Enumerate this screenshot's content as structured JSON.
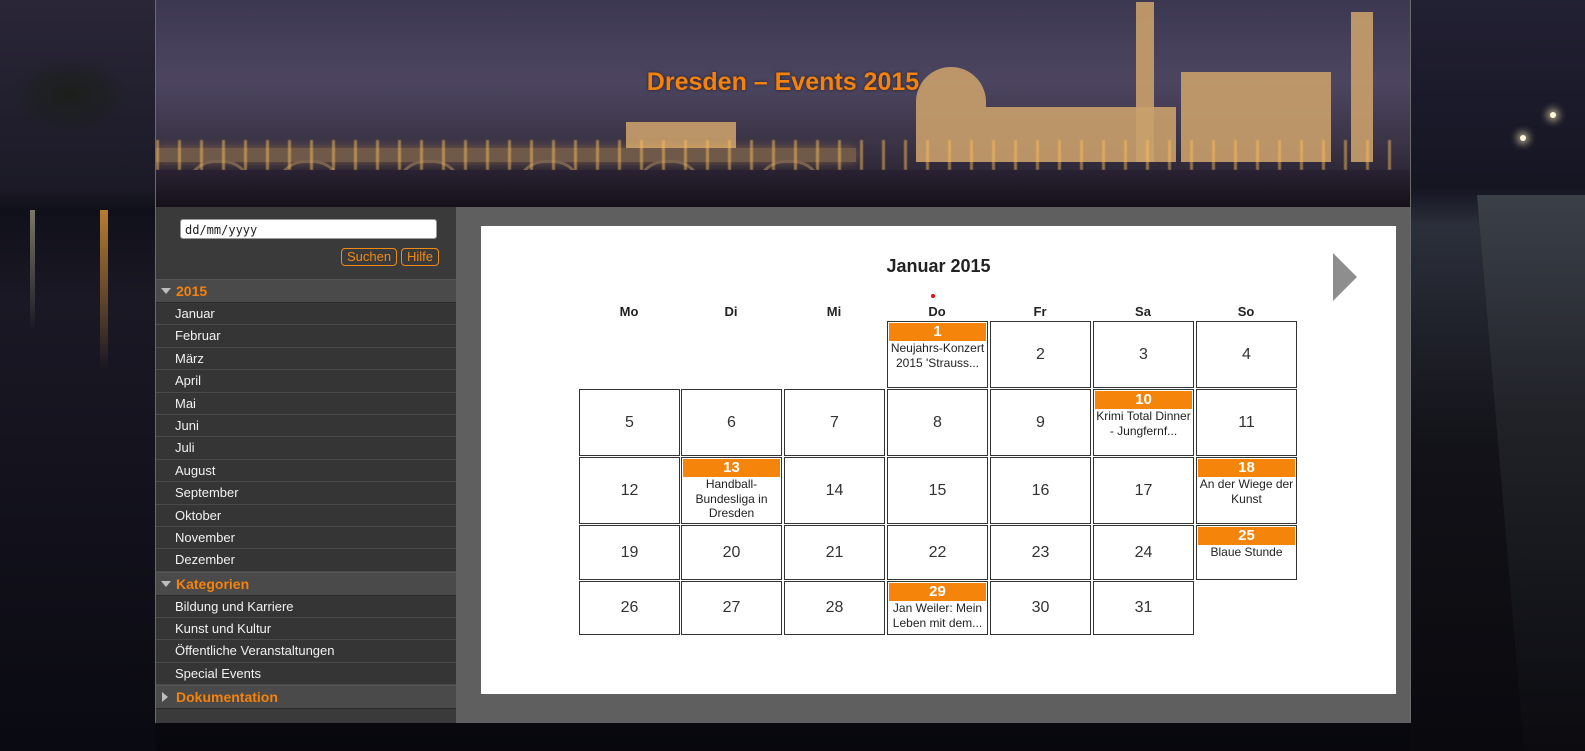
{
  "header": {
    "title": "Dresden – Events 2015"
  },
  "search": {
    "placeholder": "dd/mm/yyyy",
    "search_label": "Suchen",
    "help_label": "Hilfe"
  },
  "sidebar": {
    "year_label": "2015",
    "months": [
      "Januar",
      "Februar",
      "März",
      "April",
      "Mai",
      "Juni",
      "Juli",
      "August",
      "September",
      "Oktober",
      "November",
      "Dezember"
    ],
    "categories_label": "Kategorien",
    "categories": [
      "Bildung und Karriere",
      "Kunst und Kultur",
      "Öffentliche Veranstaltungen",
      "Special Events"
    ],
    "documentation_label": "Dokumentation"
  },
  "calendar": {
    "title": "Januar 2015",
    "weekdays": [
      "Mo",
      "Di",
      "Mi",
      "Do",
      "Fr",
      "Sa",
      "So"
    ],
    "weeks": [
      [
        null,
        null,
        null,
        {
          "day": "1",
          "event": "Neujahrs-Konzert 2015 'Strauss..."
        },
        {
          "day": "2"
        },
        {
          "day": "3"
        },
        {
          "day": "4"
        }
      ],
      [
        {
          "day": "5"
        },
        {
          "day": "6"
        },
        {
          "day": "7"
        },
        {
          "day": "8"
        },
        {
          "day": "9"
        },
        {
          "day": "10",
          "event": "Krimi Total Dinner - Jungfernf..."
        },
        {
          "day": "11"
        }
      ],
      [
        {
          "day": "12"
        },
        {
          "day": "13",
          "event": "Handball-Bundesliga in Dresden"
        },
        {
          "day": "14"
        },
        {
          "day": "15"
        },
        {
          "day": "16"
        },
        {
          "day": "17"
        },
        {
          "day": "18",
          "event": "An der Wiege der Kunst"
        }
      ],
      [
        {
          "day": "19"
        },
        {
          "day": "20"
        },
        {
          "day": "21"
        },
        {
          "day": "22"
        },
        {
          "day": "23"
        },
        {
          "day": "24"
        },
        {
          "day": "25",
          "event": "Blaue Stunde"
        }
      ],
      [
        {
          "day": "26"
        },
        {
          "day": "27"
        },
        {
          "day": "28"
        },
        {
          "day": "29",
          "event": "Jan Weiler: Mein Leben mit dem..."
        },
        {
          "day": "30"
        },
        {
          "day": "31"
        },
        null
      ]
    ]
  },
  "colors": {
    "accent": "#f5820b",
    "event_bar": "#f5840a",
    "sidebar_bg": "#353535"
  }
}
